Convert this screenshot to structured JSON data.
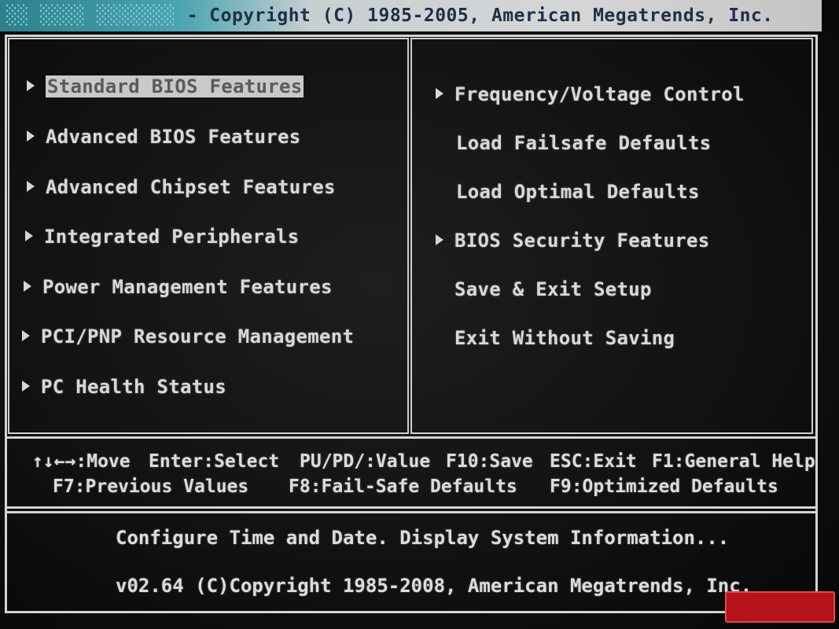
{
  "title_bar": {
    "prefix": "░░ ░░░░ ░░░░░░░",
    "text": " - Copyright (C) 1985-2005, American Megatrends, Inc."
  },
  "menu": {
    "left": [
      {
        "label": "Standard BIOS Features",
        "arrow": true,
        "selected": true
      },
      {
        "label": "Advanced BIOS Features",
        "arrow": true
      },
      {
        "label": "Advanced Chipset Features",
        "arrow": true
      },
      {
        "label": "Integrated Peripherals",
        "arrow": true
      },
      {
        "label": "Power Management Features",
        "arrow": true
      },
      {
        "label": "PCI/PNP Resource Management",
        "arrow": true
      },
      {
        "label": "PC Health Status",
        "arrow": true
      }
    ],
    "right": [
      {
        "label": "Frequency/Voltage Control",
        "arrow": true
      },
      {
        "label": "Load Failsafe Defaults",
        "arrow": false
      },
      {
        "label": "Load Optimal Defaults",
        "arrow": false
      },
      {
        "label": "BIOS Security Features",
        "arrow": true
      },
      {
        "label": "Save & Exit Setup",
        "arrow": false
      },
      {
        "label": "Exit Without Saving",
        "arrow": false
      }
    ]
  },
  "keys": {
    "row1": [
      "↑↓←→:Move",
      "Enter:Select",
      "PU/PD/:Value",
      "F10:Save",
      "ESC:Exit",
      "F1:General Help"
    ],
    "row2": [
      "F7:Previous Values",
      "F8:Fail-Safe Defaults",
      "F9:Optimized Defaults"
    ]
  },
  "help": {
    "description": "Configure Time and Date.  Display System Information...",
    "copyright": "v02.64 (C)Copyright 1985-2008, American Megatrends, Inc."
  },
  "colors": {
    "background": "#121212",
    "text": "#d9d9d9",
    "highlight_bg": "#c9c9c9",
    "highlight_text": "#5a5a5a",
    "title_bar_accent": "#4aa5b0"
  }
}
